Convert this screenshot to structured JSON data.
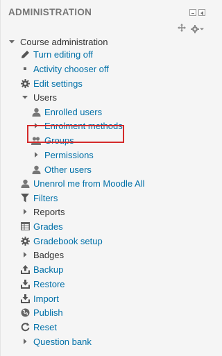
{
  "block": {
    "title": "ADMINISTRATION",
    "controls": [
      "minimize-icon",
      "dock-icon"
    ],
    "actions": [
      "move-icon",
      "gear-icon"
    ]
  },
  "tree": {
    "root": {
      "label": "Course administration",
      "icon": "caret-down-icon"
    },
    "items": [
      {
        "label": "Turn editing off",
        "icon": "pencil-icon",
        "type": "link"
      },
      {
        "label": "Activity chooser off",
        "icon": "bullet-icon",
        "type": "link"
      },
      {
        "label": "Edit settings",
        "icon": "gear-icon",
        "type": "link"
      },
      {
        "label": "Users",
        "icon": "caret-down-icon",
        "type": "plain"
      },
      {
        "label": "Enrolled users",
        "icon": "user-icon",
        "type": "link"
      },
      {
        "label": "Enrolment methods",
        "icon": "caret-right-icon",
        "type": "link"
      },
      {
        "label": "Groups",
        "icon": "users-icon",
        "type": "link"
      },
      {
        "label": "Permissions",
        "icon": "caret-right-icon",
        "type": "link"
      },
      {
        "label": "Other users",
        "icon": "user-icon",
        "type": "link"
      },
      {
        "label": "Unenrol me from Moodle All",
        "icon": "user-icon",
        "type": "link"
      },
      {
        "label": "Filters",
        "icon": "filter-icon",
        "type": "link"
      },
      {
        "label": "Reports",
        "icon": "caret-right-icon",
        "type": "plain"
      },
      {
        "label": "Grades",
        "icon": "table-icon",
        "type": "link"
      },
      {
        "label": "Gradebook setup",
        "icon": "gear-icon",
        "type": "link"
      },
      {
        "label": "Badges",
        "icon": "caret-right-icon",
        "type": "plain"
      },
      {
        "label": "Backup",
        "icon": "upload-icon",
        "type": "link"
      },
      {
        "label": "Restore",
        "icon": "download-icon",
        "type": "link"
      },
      {
        "label": "Import",
        "icon": "download-icon",
        "type": "link"
      },
      {
        "label": "Publish",
        "icon": "globe-icon",
        "type": "link"
      },
      {
        "label": "Reset",
        "icon": "reset-icon",
        "type": "link"
      },
      {
        "label": "Question bank",
        "icon": "caret-right-icon",
        "type": "link"
      }
    ]
  },
  "colors": {
    "link": "#0070a8",
    "highlight": "#d42a2a",
    "background": "#f5f5f5"
  }
}
